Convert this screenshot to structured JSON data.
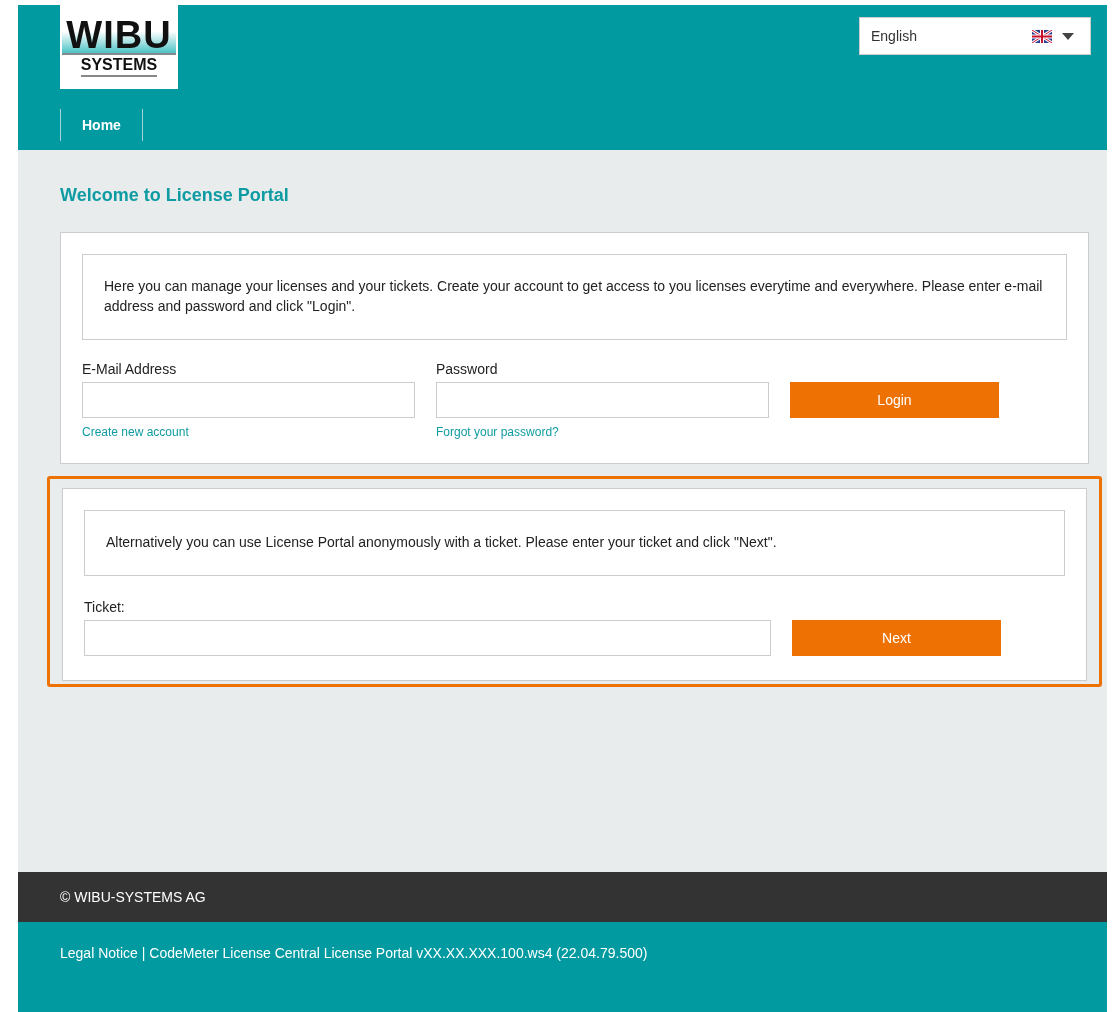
{
  "logo": {
    "line_1": "WIBU",
    "line_2": "SYSTEMS"
  },
  "language": {
    "value": "English"
  },
  "nav": [
    {
      "label": "Home",
      "selected": true
    }
  ],
  "page_title": "Welcome to License Portal",
  "login_panel": {
    "info": "Here you can manage your licenses and your tickets. Create your account to get access to you licenses everytime and everywhere. Please enter e-mail address and password and click \"Login\".",
    "fields": [
      {
        "label": "E-Mail Address",
        "link": "Create new account"
      },
      {
        "label": "Password",
        "link": "Forgot your password?"
      }
    ],
    "button": "Login"
  },
  "ticket_panel": {
    "highlighted": true,
    "info": "Alternatively you can use License Portal anonymously with a ticket. Please enter your ticket and click \"Next\".",
    "label": "Ticket:",
    "button": "Next"
  },
  "footer": {
    "copyright": "© WIBU-SYSTEMS AG",
    "legal_link": "Legal Notice",
    "version": "|  CodeMeter License Central License Portal vXX.XX.XXX.100.ws4 (22.04.79.500)"
  }
}
